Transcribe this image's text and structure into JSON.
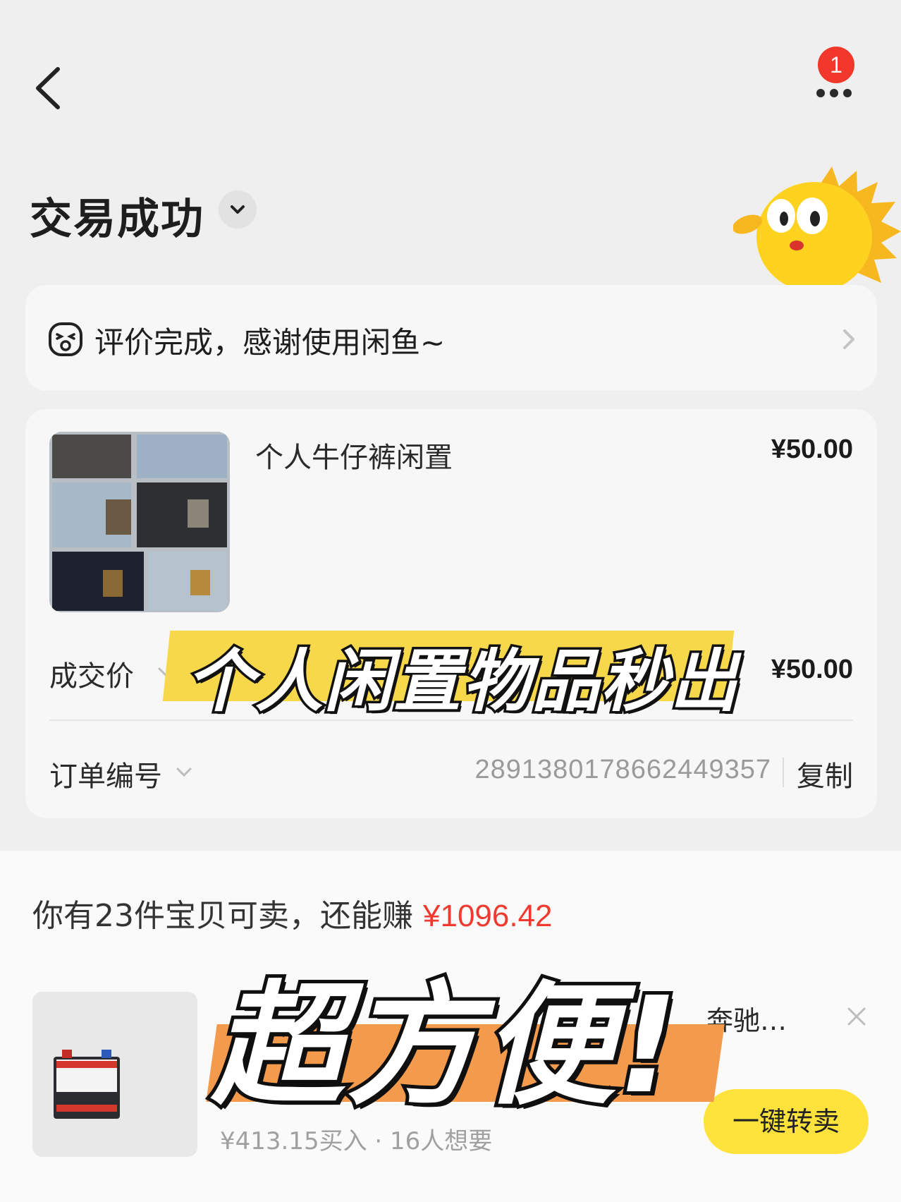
{
  "nav": {
    "notification_count": "1"
  },
  "status": {
    "title": "交易成功"
  },
  "review": {
    "text": "评价完成，感谢使用闲鱼~"
  },
  "order": {
    "product_title": "个人牛仔裤闲置",
    "product_price": "¥50.00",
    "deal_label": "成交价",
    "deal_price": "¥50.00",
    "order_label": "订单编号",
    "order_number": "2891380178662449357",
    "copy_label": "复制"
  },
  "overlay": {
    "banner1": "个人闲置物品秒出",
    "banner2": "超方便!"
  },
  "resell": {
    "prefix": "你有23件宝贝可卖，还能赚",
    "amount": "¥1096.42",
    "item_title_suffix": "奔驰…",
    "item_meta": "¥413.15买入 · 16人想要",
    "button_label": "一键转卖"
  },
  "colors": {
    "accent_yellow": "#ffe33c",
    "price_red": "#ef3b2f",
    "badge_red": "#f2372b"
  },
  "icons": [
    "back-arrow-icon",
    "more-dots-icon",
    "chevron-down-icon",
    "smiley-icon",
    "chevron-right-icon",
    "close-icon"
  ]
}
